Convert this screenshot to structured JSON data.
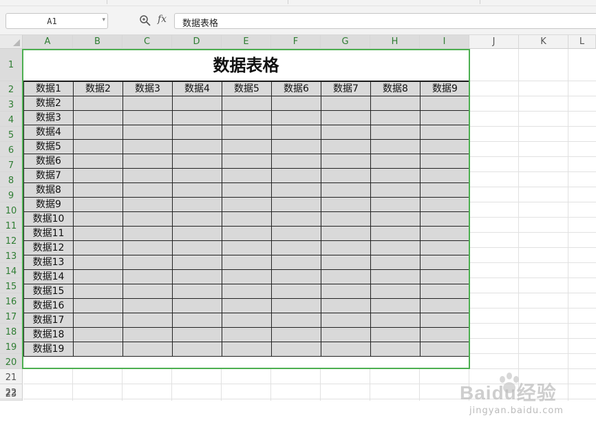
{
  "formula_bar": {
    "name_box": "A1",
    "formula_value": "数据表格",
    "fx_label": "fx"
  },
  "columns": [
    "A",
    "B",
    "C",
    "D",
    "E",
    "F",
    "G",
    "H",
    "I",
    "J",
    "K",
    "L"
  ],
  "rows": [
    "1",
    "2",
    "3",
    "4",
    "5",
    "6",
    "7",
    "8",
    "9",
    "10",
    "11",
    "12",
    "13",
    "14",
    "15",
    "16",
    "17",
    "18",
    "19",
    "20",
    "21",
    "22",
    "23"
  ],
  "sheet": {
    "title": "数据表格",
    "header_row": [
      "数据1",
      "数据2",
      "数据3",
      "数据4",
      "数据5",
      "数据6",
      "数据7",
      "数据8",
      "数据9"
    ],
    "row_labels": [
      "数据2",
      "数据3",
      "数据4",
      "数据5",
      "数据6",
      "数据7",
      "数据8",
      "数据9",
      "数据10",
      "数据11",
      "数据12",
      "数据13",
      "数据14",
      "数据15",
      "数据16",
      "数据17",
      "数据18",
      "数据19"
    ]
  },
  "watermark": {
    "brand": "Baidu经验",
    "url": "jingyan.baidu.com"
  },
  "colors": {
    "selection": "#4caf50",
    "cell_fill": "#d9d9d9",
    "header_selected_text": "#2e7d32"
  },
  "icons": {
    "zoom": "zoom-icon",
    "fx": "fx-icon",
    "dropdown": "chevron-down-icon"
  }
}
